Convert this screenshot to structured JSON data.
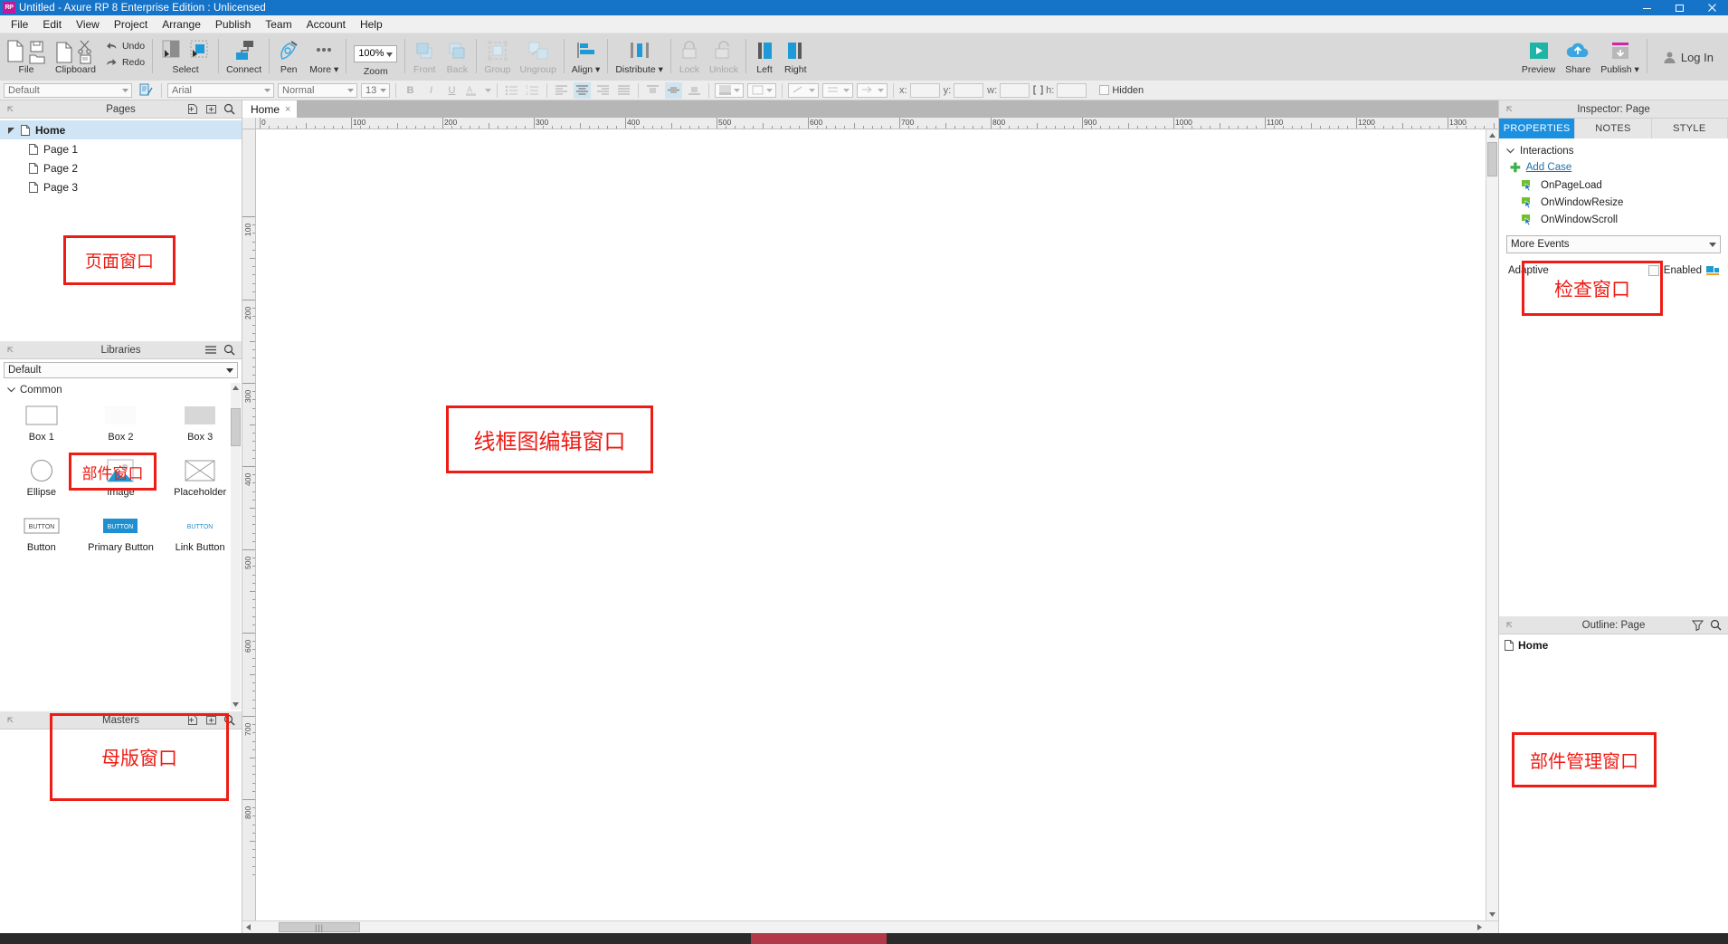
{
  "titlebar": {
    "logo": "RP",
    "title": "Untitled - Axure RP 8 Enterprise Edition : Unlicensed",
    "minimize": "minimize-icon",
    "maximize": "maximize-icon",
    "close": "close-icon"
  },
  "menubar": {
    "items": [
      "File",
      "Edit",
      "View",
      "Project",
      "Arrange",
      "Publish",
      "Team",
      "Account",
      "Help"
    ]
  },
  "ribbon": {
    "groups": [
      {
        "label": "File",
        "name": "file-group"
      },
      {
        "label": "Clipboard",
        "name": "clipboard-group"
      },
      {
        "label": "Undo",
        "name": "undo-button"
      },
      {
        "label": "Redo",
        "name": "redo-button"
      },
      {
        "label": "Select",
        "name": "select-group"
      },
      {
        "label": "Connect",
        "name": "connect-button"
      },
      {
        "label": "Pen",
        "name": "pen-button"
      },
      {
        "label": "More",
        "name": "more-button"
      },
      {
        "label": "Zoom",
        "name": "zoom-group"
      },
      {
        "label": "Front",
        "name": "front-button"
      },
      {
        "label": "Back",
        "name": "back-button"
      },
      {
        "label": "Group",
        "name": "group-button"
      },
      {
        "label": "Ungroup",
        "name": "ungroup-button"
      },
      {
        "label": "Align",
        "name": "align-button"
      },
      {
        "label": "Distribute",
        "name": "distribute-button"
      },
      {
        "label": "Lock",
        "name": "lock-button"
      },
      {
        "label": "Unlock",
        "name": "unlock-button"
      },
      {
        "label": "Left",
        "name": "left-button"
      },
      {
        "label": "Right",
        "name": "right-button"
      }
    ],
    "zoom_value": "100%",
    "right": {
      "preview": "Preview",
      "share": "Share",
      "publish": "Publish",
      "login": "Log In"
    }
  },
  "formatbar": {
    "style": "Default",
    "font": "Arial",
    "weight": "Normal",
    "size": "13",
    "bold": "B",
    "italic": "I",
    "underline": "U",
    "x_label": "x:",
    "y_label": "y:",
    "w_label": "w:",
    "h_label": "h:",
    "x_value": "",
    "y_value": "",
    "w_value": "",
    "h_value": "",
    "hidden_label": "Hidden"
  },
  "pages_panel": {
    "title": "Pages",
    "add_page_icon": "add-page-icon",
    "add_folder_icon": "add-folder-icon",
    "search_icon": "search-icon",
    "tree": [
      {
        "label": "Home",
        "level": 0,
        "selected": true
      },
      {
        "label": "Page 1",
        "level": 1,
        "selected": false
      },
      {
        "label": "Page 2",
        "level": 1,
        "selected": false
      },
      {
        "label": "Page 3",
        "level": 1,
        "selected": false
      }
    ]
  },
  "libraries_panel": {
    "title": "Libraries",
    "menu_icon": "hamburger-icon",
    "search_icon": "search-icon",
    "selected_library": "Default",
    "category": "Common",
    "widgets": [
      {
        "label": "Box 1",
        "icon": "box-1-icon"
      },
      {
        "label": "Box 2",
        "icon": "box-2-icon"
      },
      {
        "label": "Box 3",
        "icon": "box-3-icon"
      },
      {
        "label": "Ellipse",
        "icon": "ellipse-icon"
      },
      {
        "label": "Image",
        "icon": "image-icon"
      },
      {
        "label": "Placeholder",
        "icon": "placeholder-icon"
      },
      {
        "label": "Button",
        "icon": "button-icon"
      },
      {
        "label": "Primary Button",
        "icon": "primary-button-icon"
      },
      {
        "label": "Link Button",
        "icon": "link-button-icon"
      }
    ],
    "widget_face_text": "BUTTON"
  },
  "masters_panel": {
    "title": "Masters",
    "add_master_icon": "add-master-icon",
    "add_folder_icon": "add-folder-icon",
    "search_icon": "search-icon"
  },
  "canvas": {
    "tab_label": "Home",
    "tab_close": "×",
    "h_ruler_ticks": [
      "0",
      "100",
      "200",
      "300",
      "400",
      "500",
      "600",
      "700",
      "800",
      "900",
      "1000",
      "1100",
      "1200",
      "1300"
    ],
    "v_ruler_ticks": [
      "100",
      "200",
      "300",
      "400",
      "500",
      "600",
      "700",
      "800"
    ],
    "hscroll_grip": "|||"
  },
  "inspector": {
    "title": "Inspector: Page",
    "tabs": [
      {
        "label": "PROPERTIES",
        "active": true
      },
      {
        "label": "NOTES",
        "active": false
      },
      {
        "label": "STYLE",
        "active": false
      }
    ],
    "interactions_label": "Interactions",
    "add_case": "Add Case",
    "events": [
      "OnPageLoad",
      "OnWindowResize",
      "OnWindowScroll"
    ],
    "more_events": "More Events",
    "adaptive_label": "Adaptive",
    "enabled_label": "Enabled"
  },
  "outline": {
    "title": "Outline: Page",
    "filter_icon": "filter-icon",
    "search_icon": "search-icon",
    "items": [
      "Home"
    ]
  },
  "annotations": {
    "color": "#ee1c15",
    "boxes": [
      {
        "text": "页面窗口",
        "name": "annotation-pages-window"
      },
      {
        "text": "部件窗口",
        "name": "annotation-widgets-window"
      },
      {
        "text": "母版窗口",
        "name": "annotation-masters-window"
      },
      {
        "text": "线框图编辑窗口",
        "name": "annotation-wireframe-editor-window"
      },
      {
        "text": "检查窗口",
        "name": "annotation-inspector-window"
      },
      {
        "text": "部件管理窗口",
        "name": "annotation-widget-manager-window"
      }
    ]
  }
}
